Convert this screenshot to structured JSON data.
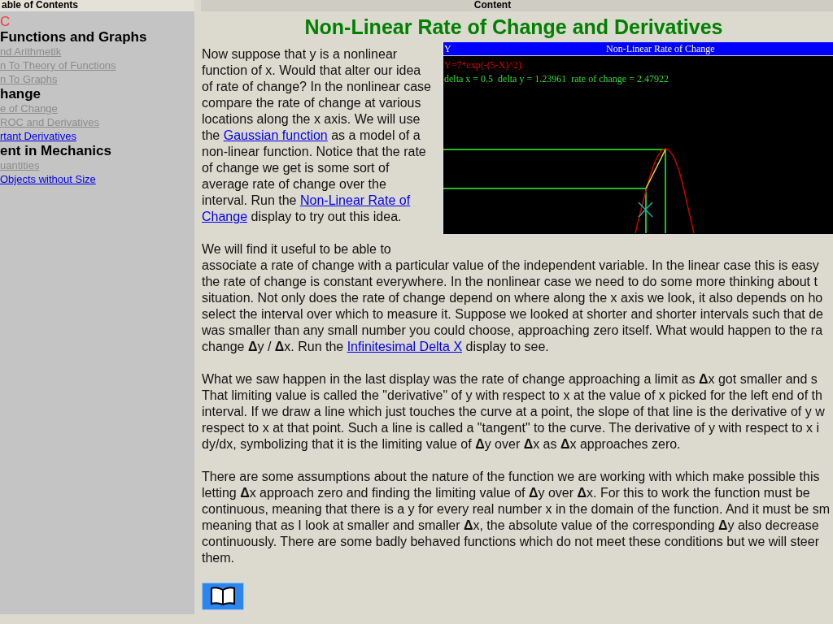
{
  "toc_frame": {
    "header": "able of Contents",
    "items": [
      {
        "kind": "current",
        "text": "C"
      },
      {
        "kind": "heading",
        "text": "Functions and Graphs"
      },
      {
        "kind": "link",
        "text": "nd Arithmetik",
        "visited": true
      },
      {
        "kind": "link",
        "text": "n To Theory of Functions",
        "visited": true
      },
      {
        "kind": "link",
        "text": "n To Graphs",
        "visited": true
      },
      {
        "kind": "heading",
        "text": "hange"
      },
      {
        "kind": "link",
        "text": "e of Change",
        "visited": true
      },
      {
        "kind": "link",
        "text": "ROC and Derivatives",
        "visited": true
      },
      {
        "kind": "link",
        "text": "rtant Derivatives",
        "visited": false
      },
      {
        "kind": "heading",
        "text": "ent in Mechanics"
      },
      {
        "kind": "link",
        "text": "uantities",
        "visited": true
      },
      {
        "kind": "link",
        "text": "Objects without Size",
        "visited": false
      }
    ]
  },
  "content_frame": {
    "header": "Content",
    "title": "Non-Linear Rate of Change and Derivatives",
    "applet": {
      "title_left": "Y",
      "title": "Non-Linear Rate of Change",
      "formula": "Y=7*exp(-(5-X)^2)",
      "readout": "delta x = 0.5  delta y = 1.23961  rate of change = 2.47922"
    },
    "intro_lines": [
      [
        {
          "text": "Now suppose that y is a nonlinear",
          "link": false
        }
      ],
      [
        {
          "text": "function of x. Would that alter our idea",
          "link": false
        }
      ],
      [
        {
          "text": "of rate of change? In the nonlinear case",
          "link": false
        }
      ],
      [
        {
          "text": "compare the rate of change at various",
          "link": false
        }
      ],
      [
        {
          "text": "locations along the x axis. We will use",
          "link": false
        }
      ],
      [
        {
          "text": "the ",
          "link": false
        },
        {
          "text": "Gaussian function",
          "link": true
        },
        {
          "text": " as a model of a",
          "link": false
        }
      ],
      [
        {
          "text": "non-linear function. Notice that the rate",
          "link": false
        }
      ],
      [
        {
          "text": "of change we get is some sort of",
          "link": false
        }
      ],
      [
        {
          "text": "average rate of change over the",
          "link": false
        }
      ],
      [
        {
          "text": "interval. Run the ",
          "link": false
        },
        {
          "text": "Non-Linear Rate of",
          "link": true
        }
      ],
      [
        {
          "text": "Change",
          "link": true
        },
        {
          "text": " display to try out this idea.",
          "link": false
        }
      ]
    ],
    "paragraphs": [
      [
        [
          {
            "text": "We will find it useful to be able to",
            "link": false
          }
        ],
        [
          {
            "text": "associate a rate of change with a particular value of the independent variable. In the linear case this is easy",
            "link": false
          }
        ],
        [
          {
            "text": "the rate of change is constant everywhere. In the nonlinear case we need to do some more thinking about t",
            "link": false
          }
        ],
        [
          {
            "text": "situation. Not only does the rate of change depend on where along the x axis we look, it also depends on ho",
            "link": false
          }
        ],
        [
          {
            "text": "select the interval over which to measure it. Suppose we looked at shorter and shorter intervals such that de",
            "link": false
          }
        ],
        [
          {
            "text": "was smaller than any small number you could choose, approaching zero itself. What would happen to the ra",
            "link": false
          }
        ],
        [
          {
            "text": "change **Δ**y / **Δ**x. Run the ",
            "link": false
          },
          {
            "text": "Infinitesimal Delta X",
            "link": true
          },
          {
            "text": " display to see.",
            "link": false
          }
        ]
      ],
      [
        [
          {
            "text": "What we saw happen in the last display was the rate of change approaching a limit as **Δ**x got smaller and s",
            "link": false
          }
        ],
        [
          {
            "text": "That limiting value is called the \"derivative\" of y with respect to x at the value of x picked for the left end of th",
            "link": false
          }
        ],
        [
          {
            "text": "interval. If we draw a line which just touches the curve at a point, the slope of that line is the derivative of y w",
            "link": false
          }
        ],
        [
          {
            "text": "respect to x at that point. Such a line is called a \"tangent\" to the curve. The derivative of y with respect to x i",
            "link": false
          }
        ],
        [
          {
            "text": "dy/dx, symbolizing that it is the limiting value of **Δ**y over **Δ**x as **Δ**x approaches zero.",
            "link": false
          }
        ]
      ],
      [
        [
          {
            "text": "There are some assumptions about the nature of the function we are working with which make possible this",
            "link": false
          }
        ],
        [
          {
            "text": "letting **Δ**x approach zero and finding the limiting value of **Δ**y over **Δ**x. For this to work the function must be",
            "link": false
          }
        ],
        [
          {
            "text": "continuous, meaning that there is a y for every real number x in the domain of the function. And it must be sm",
            "link": false
          }
        ],
        [
          {
            "text": "meaning that as I look at smaller and smaller **Δ**x, the absolute value of the corresponding **Δ**y also decrease",
            "link": false
          }
        ],
        [
          {
            "text": "continuously. There are some badly behaved functions which do not meet these conditions but we will steer",
            "link": false
          }
        ],
        [
          {
            "text": "them.",
            "link": false
          }
        ]
      ]
    ]
  }
}
